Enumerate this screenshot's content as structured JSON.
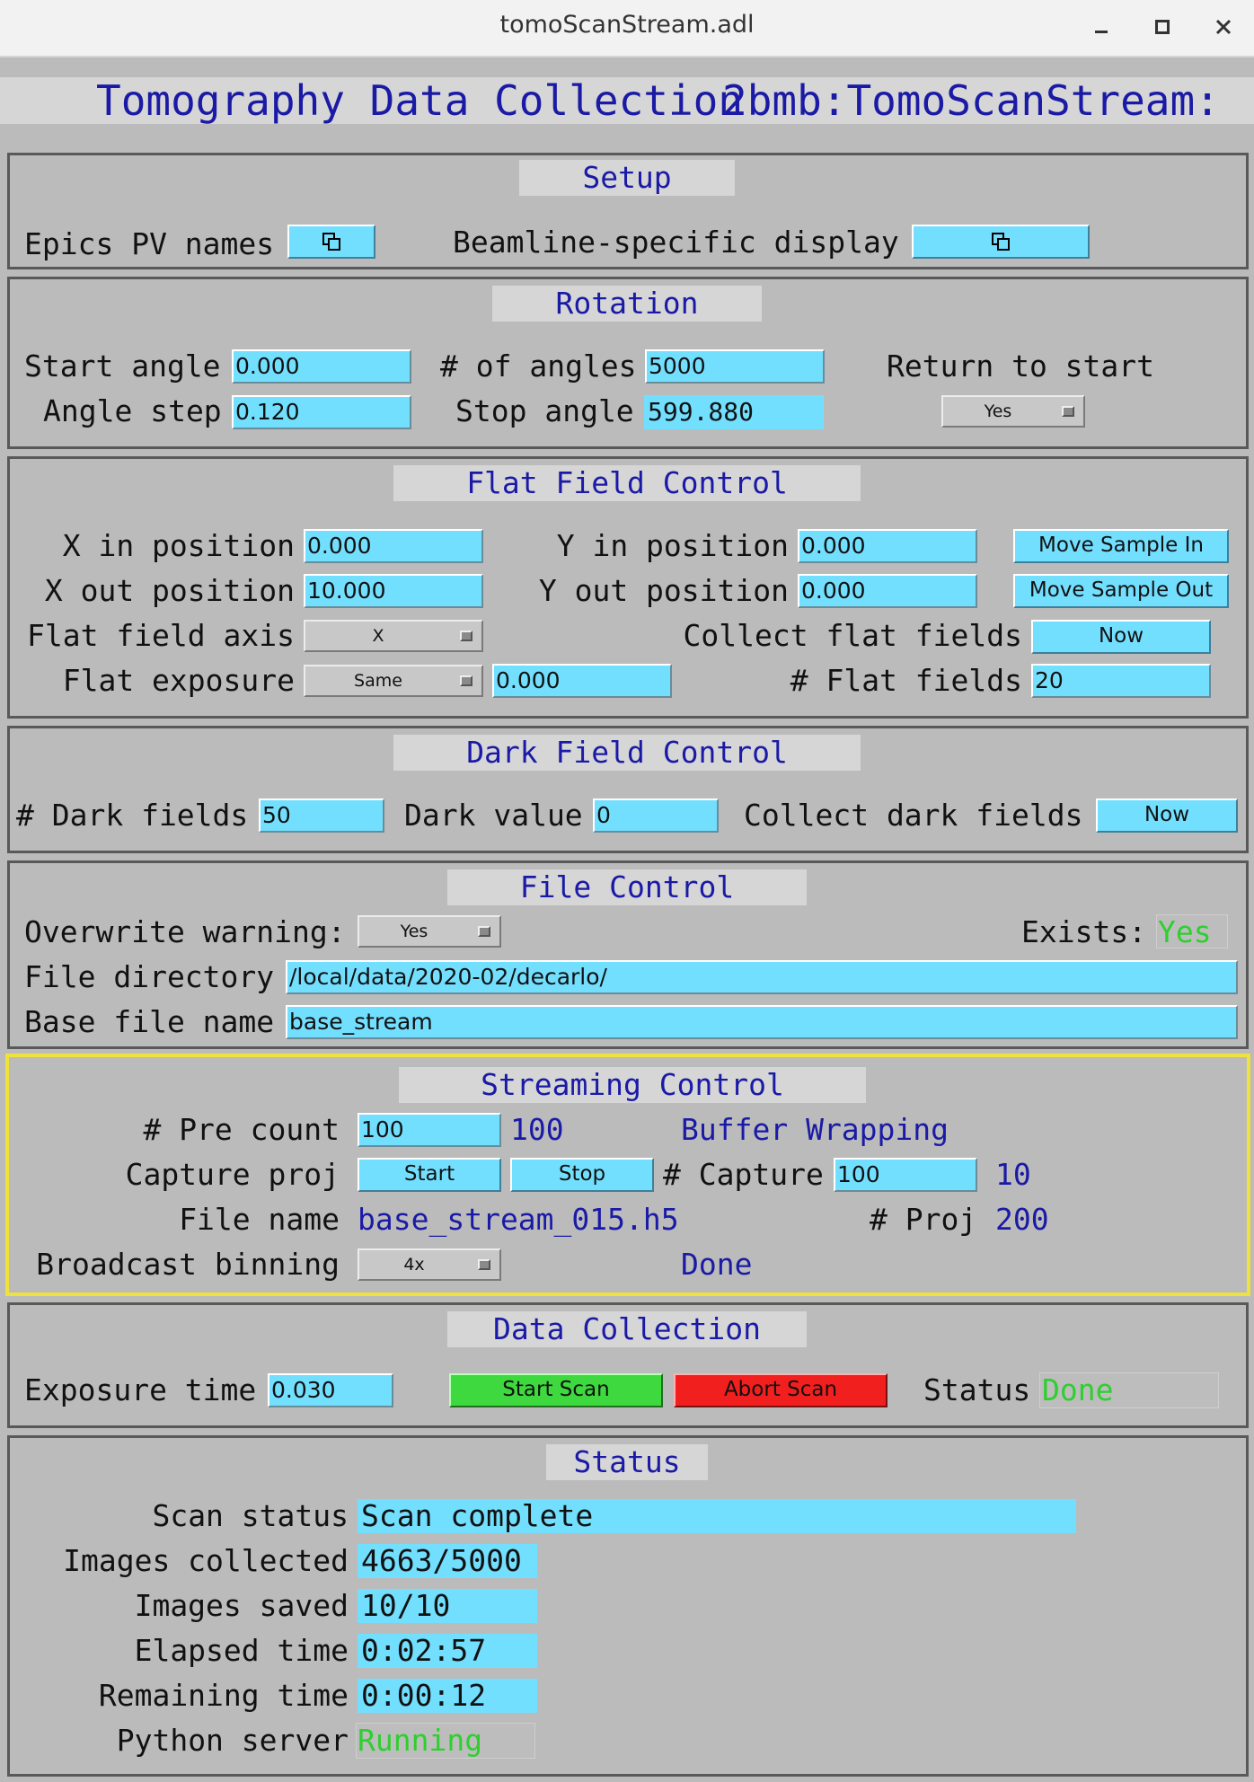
{
  "window": {
    "title": "tomoScanStream.adl"
  },
  "header": {
    "title": "Tomography Data Collection",
    "prefix": "2bmb:TomoScanStream:"
  },
  "setup": {
    "title": "Setup",
    "epics_pv_label": "Epics PV names",
    "beamline_label": "Beamline-specific display"
  },
  "rotation": {
    "title": "Rotation",
    "start_angle_label": "Start angle",
    "start_angle": "0.000",
    "num_angles_label": "# of angles",
    "num_angles": "5000",
    "return_label": "Return to start",
    "return_value": "Yes",
    "angle_step_label": "Angle step",
    "angle_step": "0.120",
    "stop_angle_label": "Stop angle",
    "stop_angle": "599.880"
  },
  "flat": {
    "title": "Flat Field Control",
    "x_in_label": "X in position",
    "x_in": "0.000",
    "y_in_label": "Y in position",
    "y_in": "0.000",
    "move_in": "Move Sample In",
    "x_out_label": "X out position",
    "x_out": "10.000",
    "y_out_label": "Y out position",
    "y_out": "0.000",
    "move_out": "Move Sample Out",
    "axis_label": "Flat field axis",
    "axis": "X",
    "collect_label": "Collect flat fields",
    "collect_btn": "Now",
    "exposure_label": "Flat exposure",
    "exposure_mode": "Same",
    "exposure": "0.000",
    "num_label": "# Flat fields",
    "num": "20"
  },
  "dark": {
    "title": "Dark Field Control",
    "num_label": "# Dark fields",
    "num": "50",
    "value_label": "Dark value",
    "value": "0",
    "collect_label": "Collect dark fields",
    "collect_btn": "Now"
  },
  "file": {
    "title": "File Control",
    "overwrite_label": "Overwrite warning:",
    "overwrite": "Yes",
    "exists_label": "Exists:",
    "exists": "Yes",
    "dir_label": "File directory",
    "dir": "/local/data/2020-02/decarlo/",
    "base_label": "Base file name",
    "base": "base_stream"
  },
  "stream": {
    "title": "Streaming Control",
    "precount_label": "# Pre count",
    "precount": "100",
    "precount_rbv": "100",
    "buffer_status": "Buffer Wrapping",
    "capture_label": "Capture proj",
    "start_btn": "Start",
    "stop_btn": "Stop",
    "num_capture_label": "# Capture",
    "num_capture": "100",
    "num_capture_rbv": "10",
    "filename_label": "File name",
    "filename": "base_stream_015.h5",
    "proj_label": "# Proj",
    "proj": "200",
    "binning_label": "Broadcast binning",
    "binning": "4x",
    "binning_status": "Done"
  },
  "collect": {
    "title": "Data Collection",
    "exposure_label": "Exposure time",
    "exposure": "0.030",
    "start_scan": "Start Scan",
    "abort_scan": "Abort Scan",
    "status_label": "Status",
    "status": "Done"
  },
  "status": {
    "title": "Status",
    "scan_status_label": "Scan status",
    "scan_status": "Scan complete",
    "images_collected_label": "Images collected",
    "images_collected": "4663/5000",
    "images_saved_label": "Images saved",
    "images_saved": "10/10",
    "elapsed_label": "Elapsed time",
    "elapsed": "0:02:57",
    "remaining_label": "Remaining time",
    "remaining": "0:00:12",
    "python_label": "Python server",
    "python": "Running"
  },
  "colors": {
    "field": "#73dfff",
    "title_blue": "#1a1aa6",
    "ok_green": "#2ecf2e",
    "start_green": "#3ed93e",
    "abort_red": "#f21f1f",
    "highlight": "#f0e23c"
  }
}
